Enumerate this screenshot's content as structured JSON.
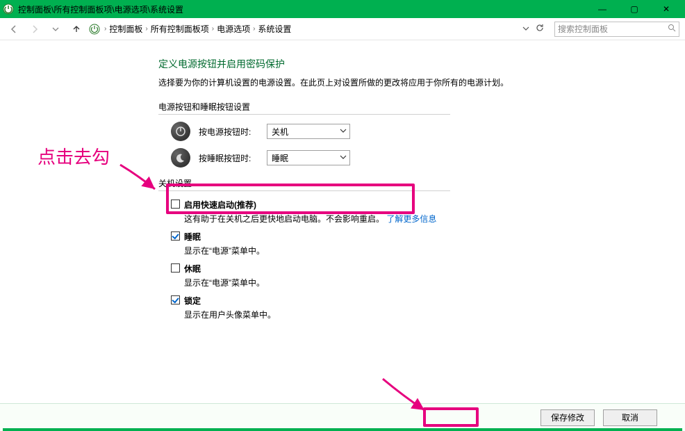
{
  "window": {
    "title": "控制面板\\所有控制面板项\\电源选项\\系统设置",
    "controls": {
      "min": "—",
      "max": "▢",
      "close": "✕"
    }
  },
  "nav": {
    "crumbs": [
      "控制面板",
      "所有控制面板项",
      "电源选项",
      "系统设置"
    ],
    "search_placeholder": "搜索控制面板"
  },
  "page": {
    "heading": "定义电源按钮并启用密码保护",
    "subtext": "选择要为你的计算机设置的电源设置。在此页上对设置所做的更改将应用于你所有的电源计划。",
    "section_buttons": {
      "title": "电源按钮和睡眠按钮设置",
      "row_power": {
        "label": "按电源按钮时:",
        "value": "关机"
      },
      "row_sleep": {
        "label": "按睡眠按钮时:",
        "value": "睡眠"
      }
    },
    "section_shutdown": {
      "title": "关机设置",
      "items": [
        {
          "checked": false,
          "label": "启用快速启动(推荐)",
          "desc_pre": "这有助于在关机之后更快地启动电脑。不会影响重启。",
          "link": "了解更多信息"
        },
        {
          "checked": true,
          "label": "睡眠",
          "desc": "显示在“电源”菜单中。"
        },
        {
          "checked": false,
          "label": "休眠",
          "desc": "显示在“电源”菜单中。"
        },
        {
          "checked": true,
          "label": "锁定",
          "desc": "显示在用户头像菜单中。"
        }
      ]
    }
  },
  "footer": {
    "save": "保存修改",
    "cancel": "取消"
  },
  "annotation": {
    "text": "点击去勾"
  }
}
